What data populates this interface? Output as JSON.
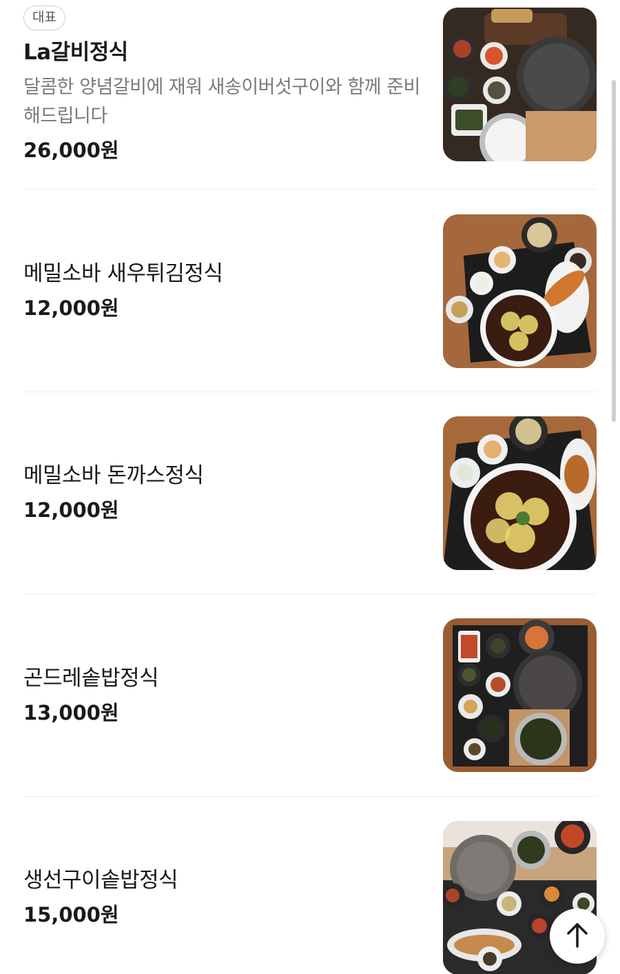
{
  "items": [
    {
      "badge": "대표",
      "name": "La갈비정식",
      "description": "달콤한 양념갈비에 재워 새송이버섯구이와 함께 준비해드립니다",
      "price": "26,000원",
      "image_alt": "La갈비정식 사진"
    },
    {
      "name": "메밀소바 새우튀김정식",
      "price": "12,000원",
      "image_alt": "메밀소바 새우튀김정식 사진"
    },
    {
      "name": "메밀소바 돈까스정식",
      "price": "12,000원",
      "image_alt": "메밀소바 돈까스정식 사진"
    },
    {
      "name": "곤드레솥밥정식",
      "price": "13,000원",
      "image_alt": "곤드레솥밥정식 사진"
    },
    {
      "name": "생선구이솥밥정식",
      "price": "15,000원",
      "image_alt": "생선구이솥밥정식 사진"
    }
  ],
  "icons": {
    "scroll_top": "arrow-up-icon"
  },
  "colors": {
    "background": "#ffffff",
    "text": "#1a1a1a",
    "description": "#7a7a7a",
    "divider": "#ececec"
  }
}
